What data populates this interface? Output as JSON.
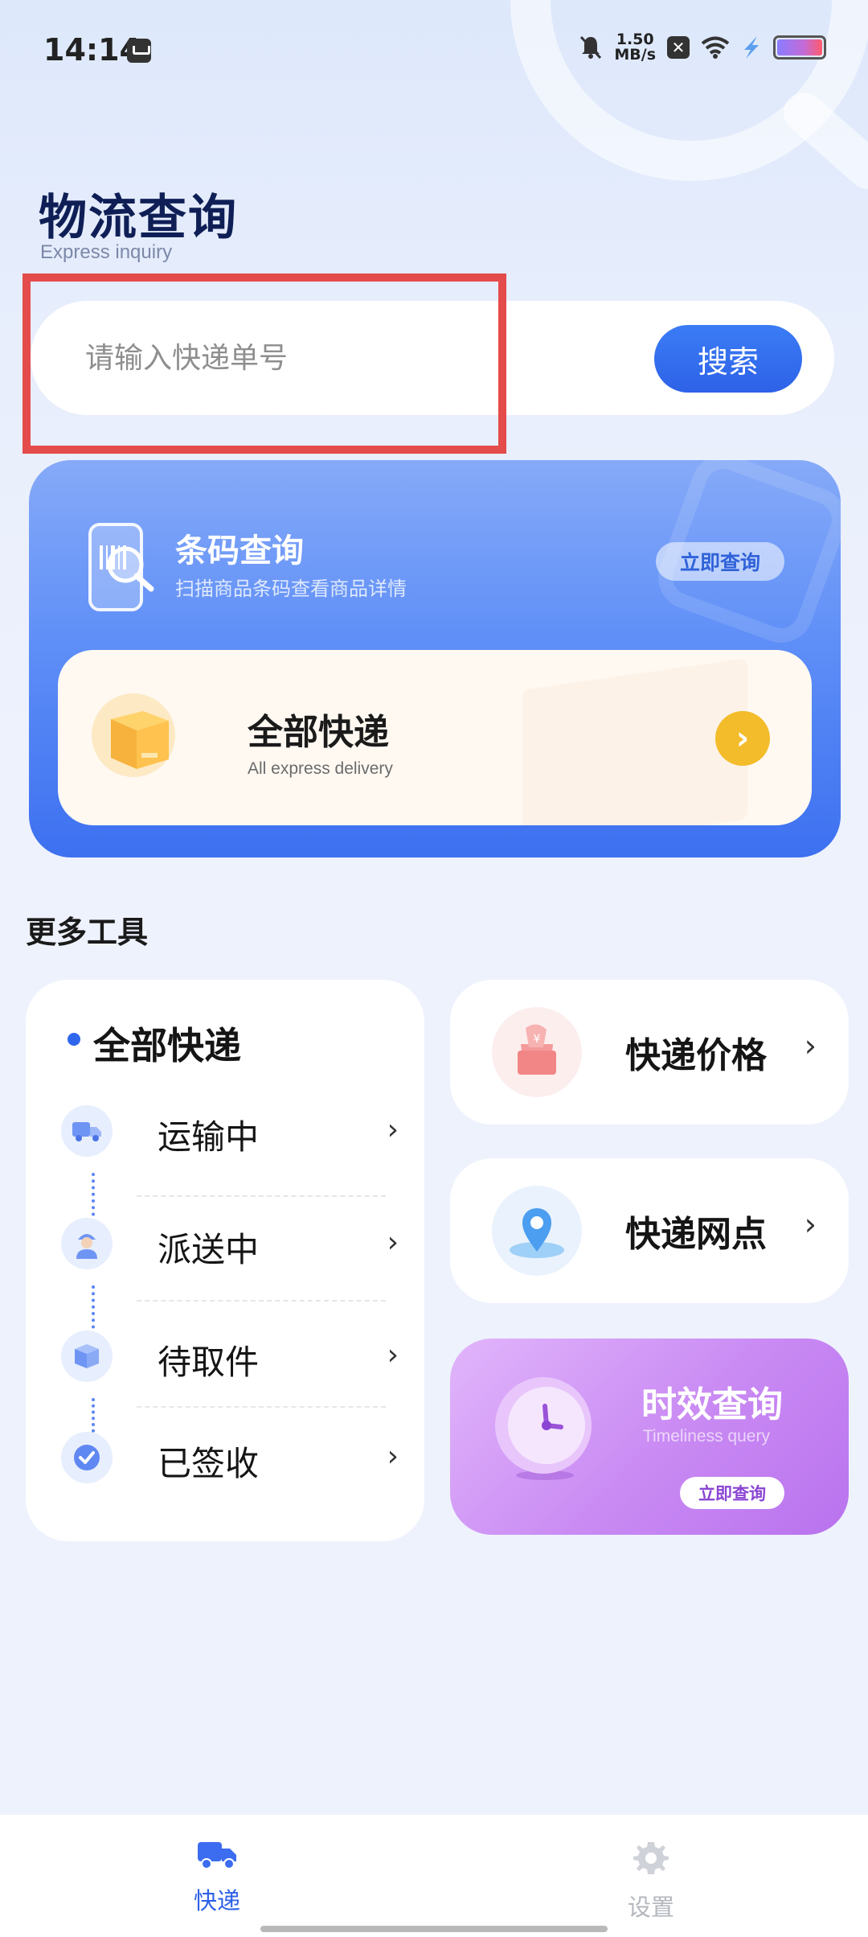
{
  "status_bar": {
    "time": "14:14",
    "net_speed_value": "1.50",
    "net_speed_unit": "MB/s",
    "icons": [
      "mute-icon",
      "close-box-icon",
      "wifi-icon",
      "bolt-icon",
      "battery-icon"
    ]
  },
  "header": {
    "title": "物流查询",
    "subtitle": "Express inquiry"
  },
  "search": {
    "placeholder": "请输入快递单号",
    "value": "",
    "button_label": "搜索"
  },
  "barcode_card": {
    "title": "条码查询",
    "description": "扫描商品条码查看商品详情",
    "button_label": "立即查询"
  },
  "all_express_card": {
    "title": "全部快递",
    "subtitle": "All express delivery"
  },
  "more_tools": {
    "title": "更多工具",
    "status_panel": {
      "title": "全部快递",
      "items": [
        {
          "label": "运输中",
          "icon": "truck-icon"
        },
        {
          "label": "派送中",
          "icon": "courier-icon"
        },
        {
          "label": "待取件",
          "icon": "package-icon"
        },
        {
          "label": "已签收",
          "icon": "check-icon"
        }
      ]
    },
    "price_card": {
      "label": "快递价格",
      "icon": "gift-box-icon"
    },
    "outlet_card": {
      "label": "快递网点",
      "icon": "location-pin-icon"
    },
    "timeliness_card": {
      "title": "时效查询",
      "subtitle": "Timeliness query",
      "button_label": "立即查询"
    }
  },
  "bottom_nav": {
    "items": [
      {
        "label": "快递",
        "icon": "truck-icon",
        "active": true
      },
      {
        "label": "设置",
        "icon": "gear-icon",
        "active": false
      }
    ]
  },
  "colors": {
    "accent": "#2f66ee",
    "title_navy": "#0f1f56",
    "arrow_yellow": "#f3bc2a",
    "purple": "#c98af3",
    "highlight_red": "#e44b4b"
  }
}
